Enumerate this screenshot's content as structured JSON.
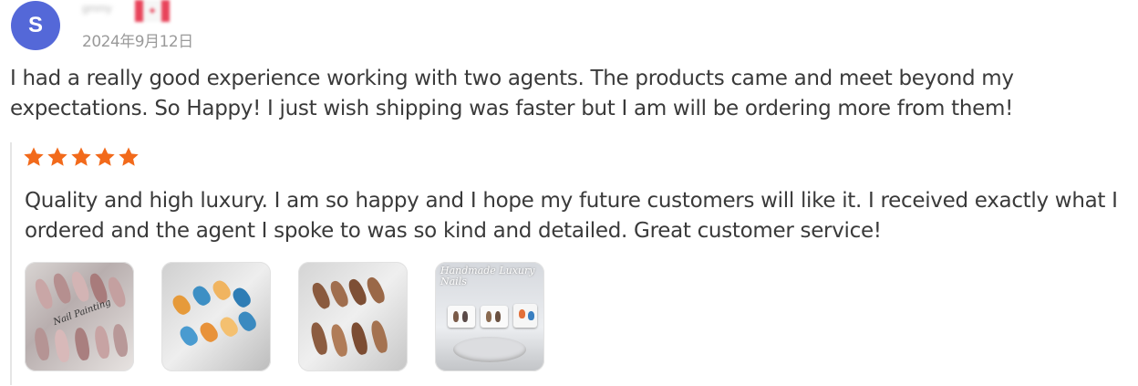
{
  "reviewer": {
    "avatar_letter": "S",
    "avatar_color": "#5468d8",
    "name": "gmmy",
    "date": "2024年9月12日"
  },
  "review_text": "I had a really good experience working with two agents. The products came and meet beyond my expectations. So Happy! I just wish shipping was faster but I am will be ordering more from them!",
  "quoted_review": {
    "rating": 5,
    "star_color": "#f26a1b",
    "text": "Quality and high luxury. I am so happy and I hope my future customers will like it. I received exactly what I ordered and the agent I spoke to was so kind and detailed. Great customer service!",
    "images": [
      {
        "label": "Nail Painting"
      },
      {
        "label": ""
      },
      {
        "label": ""
      },
      {
        "label": "Handmade Luxury Nails"
      }
    ]
  }
}
